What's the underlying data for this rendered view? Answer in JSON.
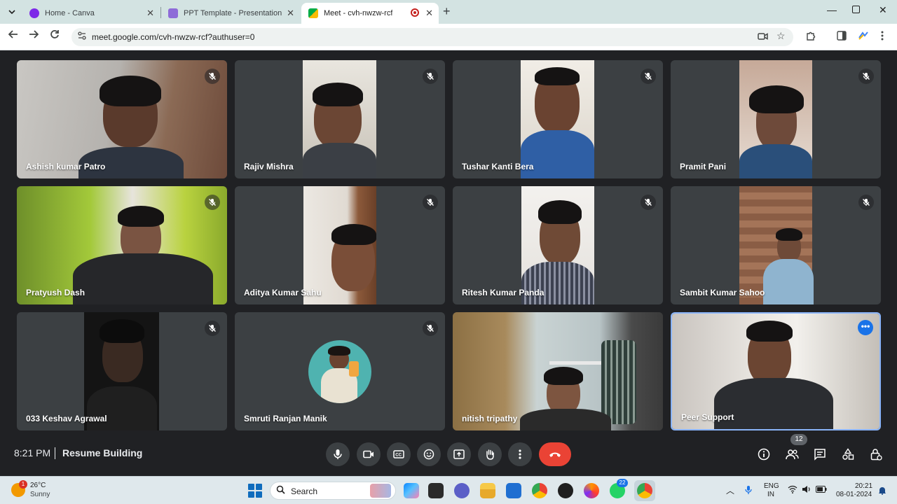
{
  "browser": {
    "tabs": [
      {
        "title": "Home - Canva",
        "favicon": "canva-icon",
        "active": false
      },
      {
        "title": "PPT Template - Presentation",
        "favicon": "presentation-icon",
        "active": false
      },
      {
        "title": "Meet - cvh-nwzw-rcf",
        "favicon": "meet-icon",
        "active": true
      }
    ],
    "url": "meet.google.com/cvh-nwzw-rcf?authuser=0"
  },
  "meet": {
    "time": "8:21 PM",
    "meeting_title": "Resume Building",
    "participants_count": "12",
    "participants": [
      {
        "name": "Ashish kumar Patro",
        "muted": true
      },
      {
        "name": "Rajiv Mishra",
        "muted": true
      },
      {
        "name": "Tushar Kanti Bera",
        "muted": true
      },
      {
        "name": "Pramit Pani",
        "muted": true
      },
      {
        "name": "Pratyush Dash",
        "muted": true
      },
      {
        "name": "Aditya Kumar Sahu",
        "muted": true
      },
      {
        "name": "Ritesh Kumar Panda",
        "muted": true
      },
      {
        "name": "Sambit Kumar Sahoo",
        "muted": true
      },
      {
        "name": "033 Keshav Agrawal",
        "muted": true
      },
      {
        "name": "Smruti Ranjan Manik",
        "muted": true
      },
      {
        "name": "nitish tripathy",
        "muted": false
      },
      {
        "name": "Peer Support",
        "muted": false
      }
    ],
    "controls": [
      "mic-icon",
      "camera-icon",
      "captions-icon",
      "emoji-icon",
      "present-icon",
      "raise-hand-icon",
      "more-options-icon",
      "end-call-icon"
    ],
    "right_controls": [
      "info-icon",
      "people-icon",
      "chat-icon",
      "activities-icon",
      "host-controls-icon"
    ]
  },
  "taskbar": {
    "weather_alert": "1",
    "temperature": "26°C",
    "condition": "Sunny",
    "search_placeholder": "Search",
    "whatsapp_badge": "22",
    "language_line1": "ENG",
    "language_line2": "IN",
    "clock_time": "20:21",
    "clock_date": "08-01-2024"
  },
  "colors": {
    "meet_bg": "#202124",
    "tile_bg": "#3c4043",
    "end_call": "#ea4335",
    "accent": "#1a73e8",
    "active_border": "#8ab4f8"
  }
}
